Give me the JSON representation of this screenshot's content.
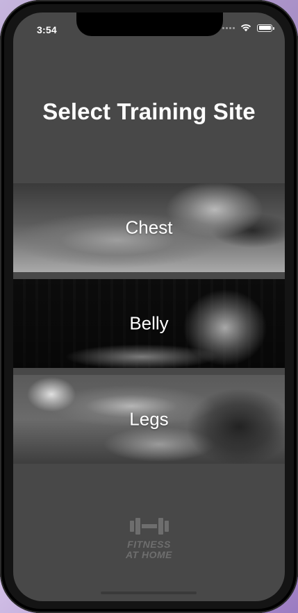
{
  "status_bar": {
    "time": "3:54"
  },
  "title": "Select Training Site",
  "sites": [
    {
      "label": "Chest"
    },
    {
      "label": "Belly"
    },
    {
      "label": "Legs"
    }
  ],
  "logo": {
    "line1": "FITNESS",
    "line2": "AT HOME",
    "icon": "dumbbell-icon"
  },
  "colors": {
    "background": "#484848",
    "text": "#ffffff",
    "logo": "#6e6e6e"
  }
}
